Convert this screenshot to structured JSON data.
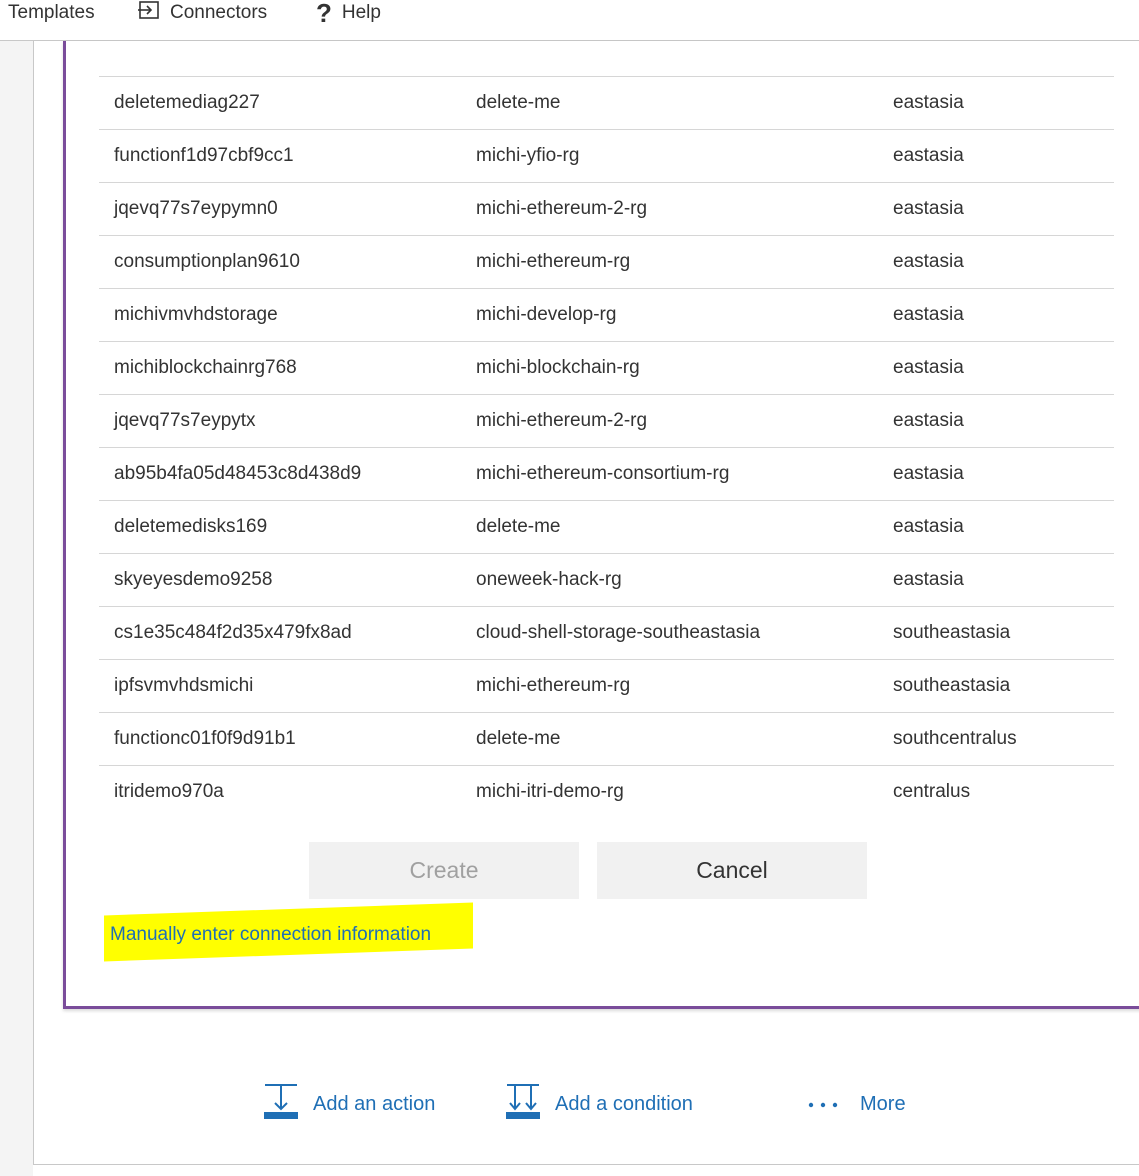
{
  "toolbar": {
    "templates_label": "Templates",
    "connectors_label": "Connectors",
    "help_label": "Help"
  },
  "storage_table": {
    "rows": [
      {
        "name": "deletemediag227",
        "resource_group": "delete-me",
        "location": "eastasia"
      },
      {
        "name": "functionf1d97cbf9cc1",
        "resource_group": "michi-yfio-rg",
        "location": "eastasia"
      },
      {
        "name": "jqevq77s7eypymn0",
        "resource_group": "michi-ethereum-2-rg",
        "location": "eastasia"
      },
      {
        "name": "consumptionplan9610",
        "resource_group": "michi-ethereum-rg",
        "location": "eastasia"
      },
      {
        "name": "michivmvhdstorage",
        "resource_group": "michi-develop-rg",
        "location": "eastasia"
      },
      {
        "name": "michiblockchainrg768",
        "resource_group": "michi-blockchain-rg",
        "location": "eastasia"
      },
      {
        "name": "jqevq77s7eypytx",
        "resource_group": "michi-ethereum-2-rg",
        "location": "eastasia"
      },
      {
        "name": "ab95b4fa05d48453c8d438d9",
        "resource_group": "michi-ethereum-consortium-rg",
        "location": "eastasia"
      },
      {
        "name": "deletemedisks169",
        "resource_group": "delete-me",
        "location": "eastasia"
      },
      {
        "name": "skyeyesdemo9258",
        "resource_group": "oneweek-hack-rg",
        "location": "eastasia"
      },
      {
        "name": "cs1e35c484f2d35x479fx8ad",
        "resource_group": "cloud-shell-storage-southeastasia",
        "location": "southeastasia"
      },
      {
        "name": "ipfsvmvhdsmichi",
        "resource_group": "michi-ethereum-rg",
        "location": "southeastasia"
      },
      {
        "name": "functionc01f0f9d91b1",
        "resource_group": "delete-me",
        "location": "southcentralus"
      },
      {
        "name": "itridemo970a",
        "resource_group": "michi-itri-demo-rg",
        "location": "centralus"
      }
    ]
  },
  "dialog": {
    "create_label": "Create",
    "cancel_label": "Cancel",
    "manual_link": "Manually enter connection information"
  },
  "flow_actions": {
    "add_action": "Add an action",
    "add_condition": "Add a condition",
    "more": "More"
  },
  "colors": {
    "card_accent": "#7a4c9a",
    "link": "#1f6fb5",
    "highlight": "#ffff00"
  }
}
